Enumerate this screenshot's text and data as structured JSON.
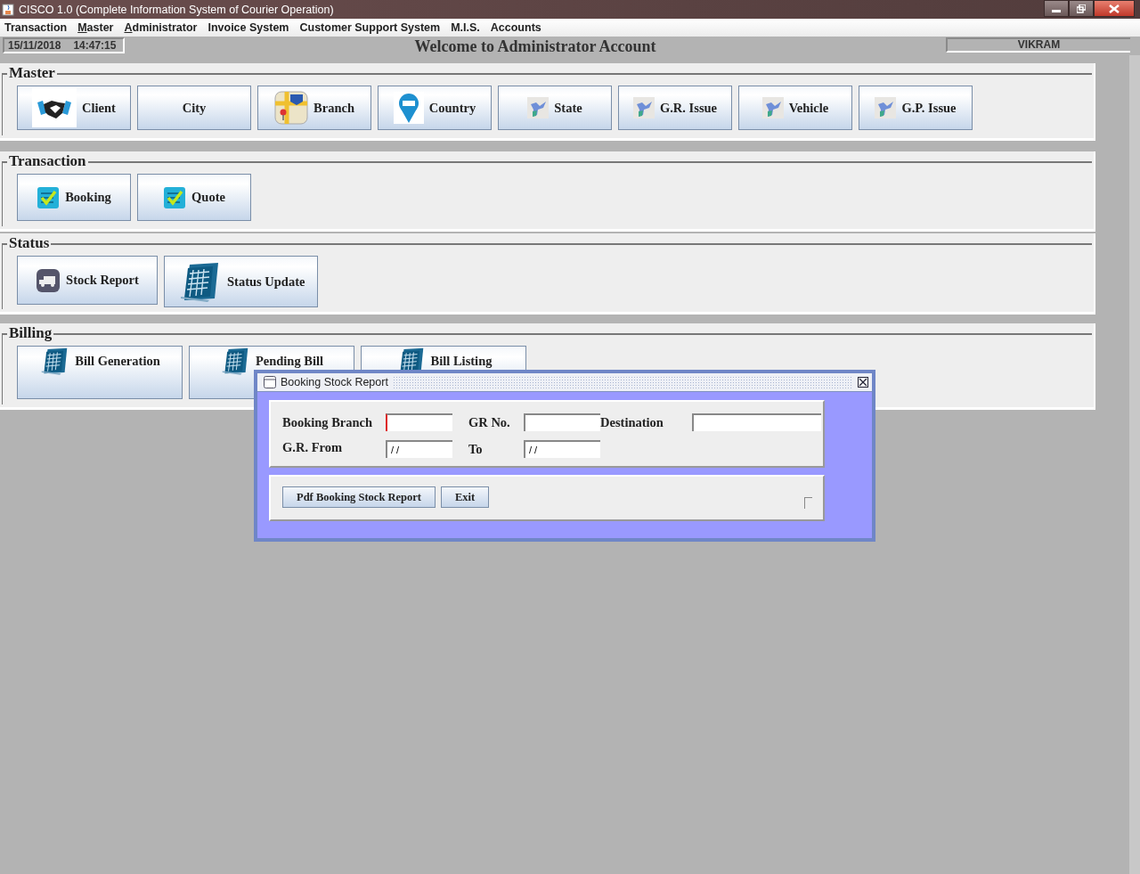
{
  "window": {
    "title": "CISCO 1.0 (Complete Information System of Courier Operation)"
  },
  "menu": [
    {
      "label": "Transaction",
      "mnemonic": false
    },
    {
      "label": "Master",
      "mnemonic": true
    },
    {
      "label": "Administrator",
      "mnemonic": true
    },
    {
      "label": "Invoice System",
      "mnemonic": false
    },
    {
      "label": "Customer Support System",
      "mnemonic": false
    },
    {
      "label": "M.I.S.",
      "mnemonic": false
    },
    {
      "label": "Accounts",
      "mnemonic": false
    }
  ],
  "status_row": {
    "date": "15/11/2018",
    "time": "14:47:15",
    "welcome": "Welcome to Administrator Account",
    "user": "VIKRAM"
  },
  "sections": [
    {
      "title": "Master",
      "buttons": [
        "Client",
        "City",
        "Branch",
        "Country",
        "State",
        "G.R. Issue",
        "Vehicle",
        "G.P. Issue"
      ]
    },
    {
      "title": "Transaction",
      "buttons": [
        "Booking",
        "Quote"
      ]
    },
    {
      "title": "Status",
      "buttons": [
        "Stock Report",
        "Status Update"
      ]
    },
    {
      "title": "Billing",
      "buttons": [
        "Bill Generation",
        "Pending Bill",
        "Bill Listing"
      ]
    }
  ],
  "dialog": {
    "title": "Booking Stock Report",
    "fields": [
      {
        "label": "Booking Branch"
      },
      {
        "label": "GR No."
      },
      {
        "label": "Destination"
      },
      {
        "label": "G.R. From",
        "value": "/ /"
      },
      {
        "label": "To",
        "value": "/ /"
      }
    ],
    "buttons": [
      "Pdf Booking Stock Report",
      "Exit"
    ]
  }
}
